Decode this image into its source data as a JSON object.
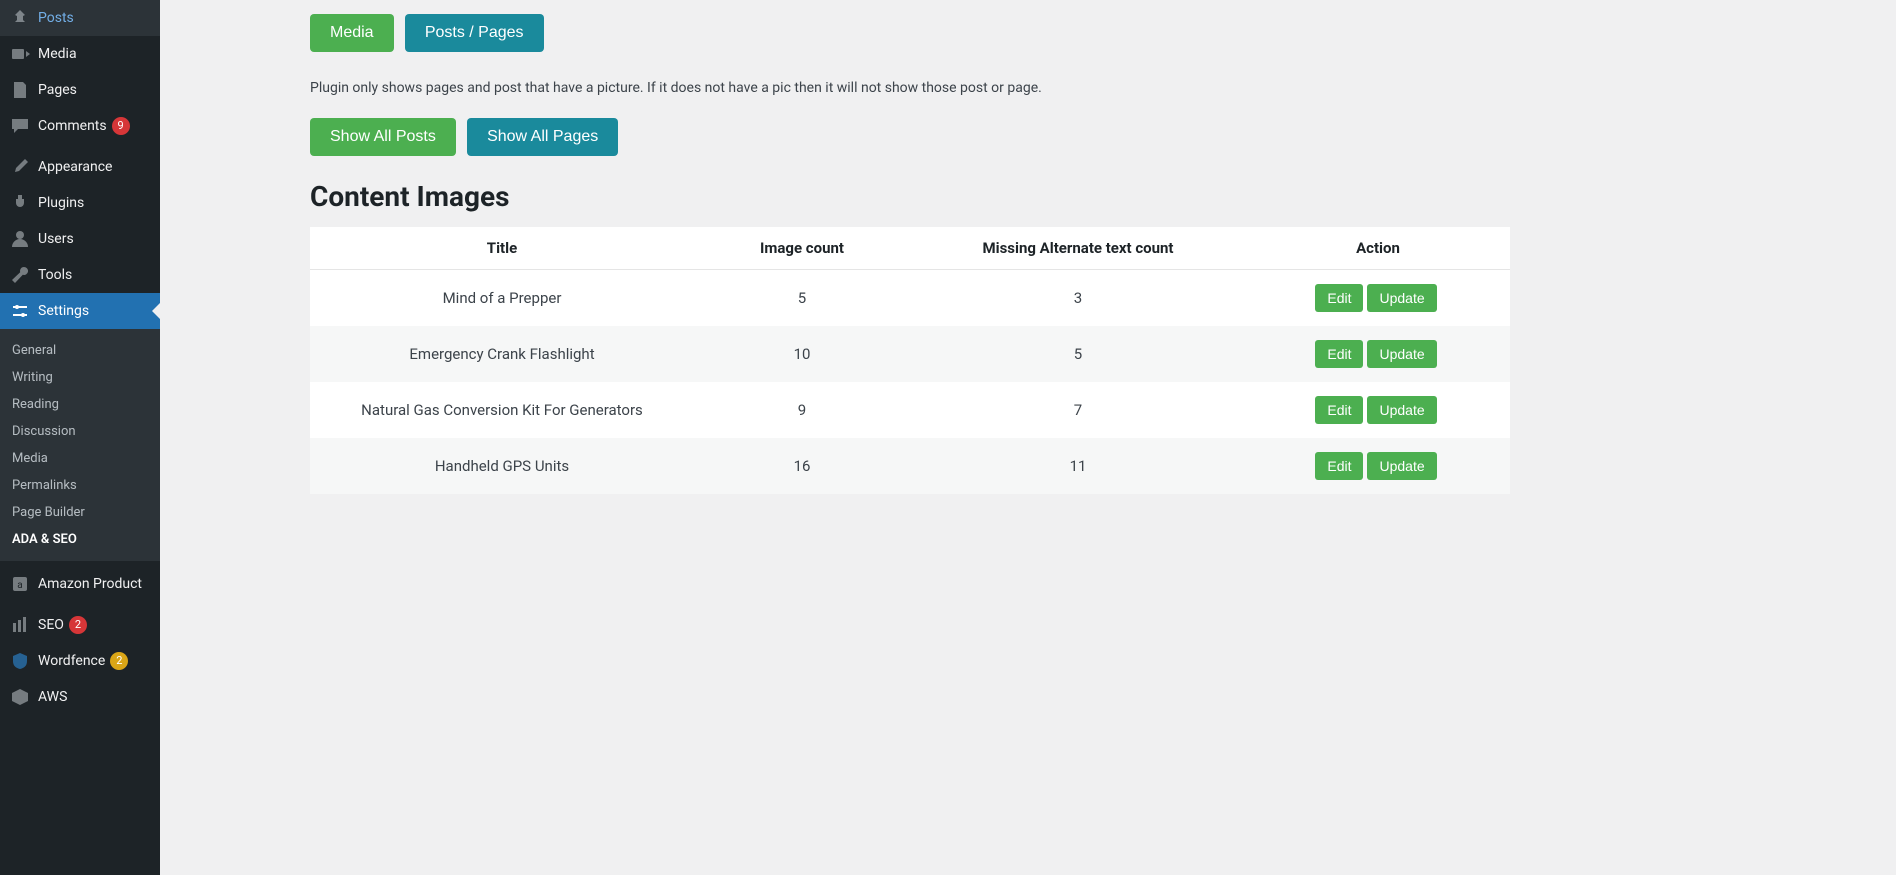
{
  "sidebar": {
    "items": [
      {
        "id": "posts",
        "label": "Posts",
        "icon": "pin",
        "type": "item"
      },
      {
        "id": "media",
        "label": "Media",
        "icon": "media",
        "type": "item"
      },
      {
        "id": "pages",
        "label": "Pages",
        "icon": "page",
        "type": "item"
      },
      {
        "id": "comments",
        "label": "Comments",
        "icon": "comment",
        "type": "item",
        "badge": {
          "text": "9",
          "cls": "badge-red"
        }
      },
      {
        "type": "sep"
      },
      {
        "id": "appearance",
        "label": "Appearance",
        "icon": "brush",
        "type": "item"
      },
      {
        "id": "plugins",
        "label": "Plugins",
        "icon": "plug",
        "type": "item"
      },
      {
        "id": "users",
        "label": "Users",
        "icon": "user",
        "type": "item"
      },
      {
        "id": "tools",
        "label": "Tools",
        "icon": "wrench",
        "type": "item"
      },
      {
        "id": "settings",
        "label": "Settings",
        "icon": "sliders",
        "type": "item",
        "current": true,
        "submenu": [
          {
            "id": "general",
            "label": "General"
          },
          {
            "id": "writing",
            "label": "Writing"
          },
          {
            "id": "reading",
            "label": "Reading"
          },
          {
            "id": "discussion",
            "label": "Discussion"
          },
          {
            "id": "media",
            "label": "Media"
          },
          {
            "id": "permalinks",
            "label": "Permalinks"
          },
          {
            "id": "pagebuilder",
            "label": "Page Builder"
          },
          {
            "id": "adaseo",
            "label": "ADA & SEO",
            "active": true
          }
        ]
      },
      {
        "type": "sep"
      },
      {
        "id": "amazon",
        "label": "Amazon Product",
        "icon": "amazon",
        "type": "item"
      },
      {
        "type": "sep"
      },
      {
        "id": "seo",
        "label": "SEO",
        "icon": "seo",
        "type": "item",
        "badge": {
          "text": "2",
          "cls": "badge-red"
        }
      },
      {
        "id": "wordfence",
        "label": "Wordfence",
        "icon": "shield",
        "type": "item",
        "badge": {
          "text": "2",
          "cls": "badge-yellow"
        }
      },
      {
        "id": "aws",
        "label": "AWS",
        "icon": "box",
        "type": "item"
      }
    ]
  },
  "content": {
    "tabs": {
      "media": "Media",
      "posts_pages": "Posts / Pages"
    },
    "helper_text": "Plugin only shows pages and post that have a picture. If it does not have a pic then it will not show those post or page.",
    "show_all_posts": "Show All Posts",
    "show_all_pages": "Show All Pages",
    "heading": "Content Images",
    "table": {
      "headers": [
        "Title",
        "Image count",
        "Missing Alternate text count",
        "Action"
      ],
      "edit_label": "Edit",
      "update_label": "Update",
      "rows": [
        {
          "title": "Mind of a Prepper",
          "image_count": "5",
          "missing_alt": "3"
        },
        {
          "title": "Emergency Crank Flashlight",
          "image_count": "10",
          "missing_alt": "5"
        },
        {
          "title": "Natural Gas Conversion Kit For Generators",
          "image_count": "9",
          "missing_alt": "7"
        },
        {
          "title": "Handheld GPS Units",
          "image_count": "16",
          "missing_alt": "11"
        }
      ]
    }
  },
  "colors": {
    "green": "#4CAF50",
    "teal": "#1a8a9c",
    "wp_blue": "#2271b1"
  }
}
